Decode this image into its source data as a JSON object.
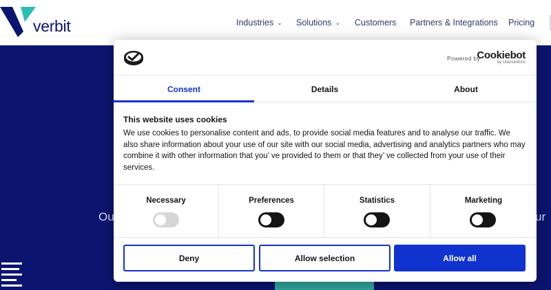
{
  "site": {
    "logo_text": "verbit",
    "nav": [
      {
        "label": "Industries",
        "has_dropdown": true
      },
      {
        "label": "Solutions",
        "has_dropdown": true
      },
      {
        "label": "Customers",
        "has_dropdown": false
      },
      {
        "label": "Partners & Integrations",
        "has_dropdown": false
      },
      {
        "label": "Pricing",
        "has_dropdown": false
      }
    ],
    "hero_left_text": "Ou",
    "hero_right_text": "ur",
    "colors": {
      "brand": "#0b1570",
      "accent_teal": "#33a8a0",
      "logo_teal": "#2bbfb3"
    }
  },
  "cookie": {
    "powered_by": "Powered by",
    "brand": "Cookiebot",
    "brand_sub": "by Usercentrics",
    "tabs": [
      {
        "label": "Consent",
        "active": true
      },
      {
        "label": "Details",
        "active": false
      },
      {
        "label": "About",
        "active": false
      }
    ],
    "title": "This website uses cookies",
    "body": "We use cookies to personalise content and ads, to provide social media features and to analyse our traffic. We also share information about your use of our site with our social media, advertising and analytics partners who may combine it with other information that you’ ve provided to them or that they’ ve collected from your use of their services.",
    "categories": [
      {
        "label": "Necessary",
        "enabled": false,
        "locked": true
      },
      {
        "label": "Preferences",
        "enabled": false,
        "locked": false
      },
      {
        "label": "Statistics",
        "enabled": false,
        "locked": false
      },
      {
        "label": "Marketing",
        "enabled": false,
        "locked": false
      }
    ],
    "buttons": {
      "deny": "Deny",
      "allow_selection": "Allow selection",
      "allow_all": "Allow all"
    },
    "colors": {
      "accent": "#1032cf",
      "toggle_off": "#141414",
      "toggle_disabled": "#d6d6d6"
    }
  }
}
